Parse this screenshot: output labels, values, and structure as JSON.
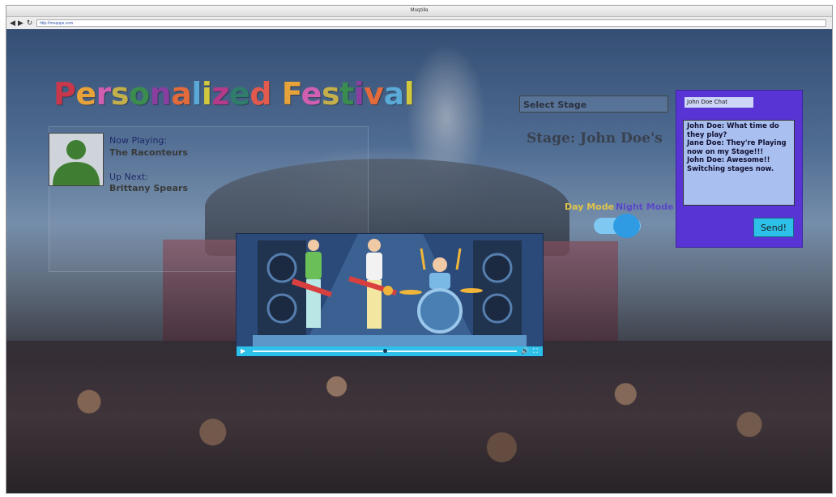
{
  "browser": {
    "window_title": "Moqzilla",
    "url": "http://moqups.com",
    "icons": [
      "back-arrow-icon",
      "forward-arrow-icon",
      "reload-icon"
    ]
  },
  "page": {
    "title": "Personalized Festival",
    "title_colors": [
      "#c9384a",
      "#e8a23a",
      "#d05fb2",
      "#c4b04a",
      "#3b8d4f",
      "#8a3fa0",
      "#e36b3b",
      "#5aa9d6",
      "#d1c83e",
      "#b53a8a",
      "#2f7d6a",
      "#e25a4d"
    ]
  },
  "now_playing": {
    "avatar_icon": "person-silhouette-icon",
    "now_label": "Now Playing:",
    "now_value": "The Raconteurs",
    "next_label": "Up Next:",
    "next_value": "Brittany Spears"
  },
  "video": {
    "illustration": "band-on-stage-illustration",
    "progress": 0.5,
    "accent": "#2dc0e8",
    "controls": [
      "play-icon",
      "volume-icon",
      "fullscreen-icon"
    ]
  },
  "stage": {
    "select_label": "Select Stage",
    "current_stage": "Stage: John Doe's"
  },
  "mode": {
    "day_label": "Day Mode",
    "night_label": "Night Mode",
    "day_color": "#e0c44a",
    "night_color": "#5a48c8",
    "selected": "night"
  },
  "chat": {
    "title": "John Doe Chat",
    "panel_color": "#5834d4",
    "messages": [
      "John Doe: What time do they play?",
      "Jane Doe: They're Playing now on my Stage!!!",
      "John Doe: Awesome!! Switching stages now."
    ],
    "send_label": "Send!"
  }
}
